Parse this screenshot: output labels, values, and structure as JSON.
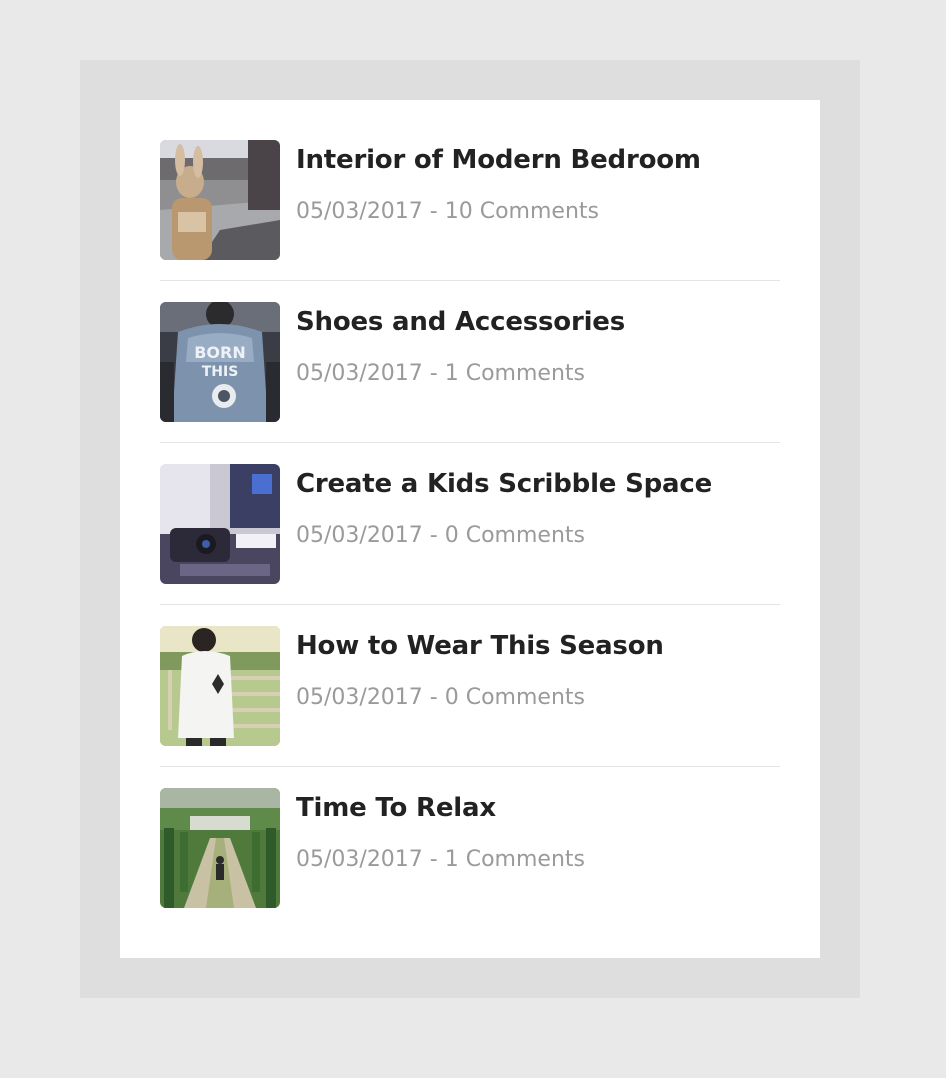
{
  "posts": [
    {
      "title": "Interior of Modern Bedroom",
      "date": "05/03/2017",
      "separator": " - ",
      "comments": "10 Comments",
      "thumbnail": "person-in-rabbit-costume-photo"
    },
    {
      "title": "Shoes and Accessories",
      "date": "05/03/2017",
      "separator": " - ",
      "comments": "1 Comments",
      "thumbnail": "denim-jacket-back-photo"
    },
    {
      "title": "Create a Kids Scribble Space",
      "date": "05/03/2017",
      "separator": " - ",
      "comments": "0 Comments",
      "thumbnail": "desk-with-camera-photo"
    },
    {
      "title": "How to Wear This Season",
      "date": "05/03/2017",
      "separator": " - ",
      "comments": "0 Comments",
      "thumbnail": "person-at-gate-field-photo"
    },
    {
      "title": "Time To Relax",
      "date": "05/03/2017",
      "separator": " - ",
      "comments": "1 Comments",
      "thumbnail": "person-on-garden-path-photo"
    }
  ],
  "colors": {
    "page_background": "#e9e9e9",
    "frame_background": "#dedede",
    "card_background": "#ffffff",
    "title": "#222222",
    "meta": "#9a9a9a",
    "divider": "#e4e4e4"
  }
}
